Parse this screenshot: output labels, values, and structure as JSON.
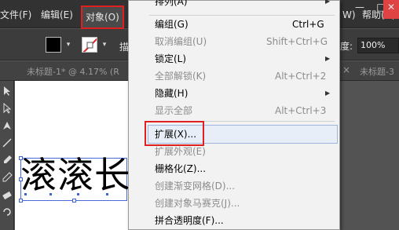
{
  "menubar": {
    "items": [
      "文件(F)",
      "编辑(E)",
      "对象(O)"
    ],
    "right_items": [
      "W)",
      "帮助(H)"
    ],
    "window_buttons": [
      "—",
      "□",
      "✕"
    ]
  },
  "controlbar": {
    "partial_label": "描",
    "opacity_label": "度:",
    "opacity_value": "100%"
  },
  "tabs": {
    "doc1": "未标题-1* @ 4.17% (R",
    "doc2": "未标题-3",
    "close": "×"
  },
  "canvas": {
    "text": "滚滚长"
  },
  "object_menu": {
    "top_partial": "排列(A)",
    "items": [
      {
        "label": "编组(G)",
        "shortcut": "Ctrl+G",
        "enabled": true
      },
      {
        "label": "取消编组(U)",
        "shortcut": "Shift+Ctrl+G",
        "enabled": false
      },
      {
        "label": "锁定(L)",
        "shortcut": "",
        "enabled": true,
        "submenu": true
      },
      {
        "label": "全部解锁(K)",
        "shortcut": "Alt+Ctrl+2",
        "enabled": false
      },
      {
        "label": "隐藏(H)",
        "shortcut": "",
        "enabled": true,
        "submenu": true
      },
      {
        "label": "显示全部",
        "shortcut": "Alt+Ctrl+3",
        "enabled": false
      },
      {
        "label": "扩展(X)...",
        "shortcut": "",
        "enabled": true,
        "highlighted": true
      },
      {
        "label": "扩展外观(E)",
        "shortcut": "",
        "enabled": false
      },
      {
        "label": "栅格化(Z)...",
        "shortcut": "",
        "enabled": true
      },
      {
        "label": "创建渐变网格(D)...",
        "shortcut": "",
        "enabled": false
      },
      {
        "label": "创建对象马赛克(J)...",
        "shortcut": "",
        "enabled": false
      },
      {
        "label": "拼合透明度(F)...",
        "shortcut": "",
        "enabled": true
      }
    ]
  },
  "colors": {
    "highlight_border": "#e02020",
    "selection": "#3b63d6",
    "menu_bg": "#f2f2f2",
    "app_bg": "#323232"
  }
}
